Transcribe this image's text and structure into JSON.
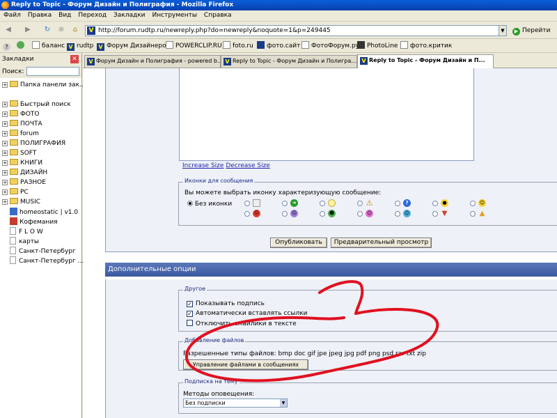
{
  "window": {
    "title": "Reply to Topic - Форум Дизайн и Полиграфия - Mozilla Firefox"
  },
  "menu": [
    "Файл",
    "Правка",
    "Вид",
    "Переход",
    "Закладки",
    "Инструменты",
    "Справка"
  ],
  "nav": {
    "url": "http://forum.rudtp.ru/newreply.php?do=newreply&noquote=1&p=249445",
    "go_label": "Перейти"
  },
  "bookmarks_bar": [
    "баланс",
    "rudtp",
    "Форум Дизайнеров",
    "POWERCLIP.RU",
    "foto.ru",
    "фото.сайт",
    "ФотоФорум.ру",
    "PhotoLine",
    "фото.критик"
  ],
  "sidebar": {
    "title": "Закладки",
    "search_label": "Поиск:",
    "panel_folder": "Папка панели зак...",
    "folders": [
      "Быстрый поиск",
      "ФОТО",
      "ПОЧТА",
      "forum",
      "ПОЛИГРАФИЯ",
      "SOFT",
      "КНИГИ",
      "ДИЗАЙН",
      "РАЗНОЕ",
      "PC",
      "MUSIC"
    ],
    "links": [
      "homeostatic | v1.0",
      "Кофемания",
      "F L O W",
      "карты",
      "Санкт-Петербург",
      "Санкт-Петербург ..."
    ]
  },
  "tabs": [
    {
      "label": "Форум Дизайн и Полиграфия - powered b..."
    },
    {
      "label": "Reply to Topic - Форум Дизайн и Полигра..."
    },
    {
      "label": "Reply to Topic - Форум Дизайн и П..."
    }
  ],
  "editor": {
    "increase_size": "Increase Size",
    "decrease_size": "Decrease Size"
  },
  "icons_section": {
    "legend": "Иконки для сообщения",
    "description": "Вы можете выбрать иконку характеризующую сообщение:",
    "no_icon_label": "Без иконки"
  },
  "actions": {
    "publish": "Опубликовать",
    "preview": "Предварительный просмотр"
  },
  "additional": {
    "header": "Дополнительные опции",
    "other_legend": "Другое",
    "show_signature": "Показывать подпись",
    "auto_links": "Автоматически вставлять ссылки",
    "disable_smilies": "Отключить смайлики в тексте",
    "attachments_legend": "Добавление файлов",
    "allowed_types": "Разрешенные типы файлов: bmp doc gif jpe jpeg jpg pdf png psd rar txt zip",
    "manage_attachments": "Управление файлами в сообщениях",
    "subscription_legend": "Подписка на тему",
    "notify_label": "Методы оповещения:",
    "notify_value": "Без подписки"
  }
}
